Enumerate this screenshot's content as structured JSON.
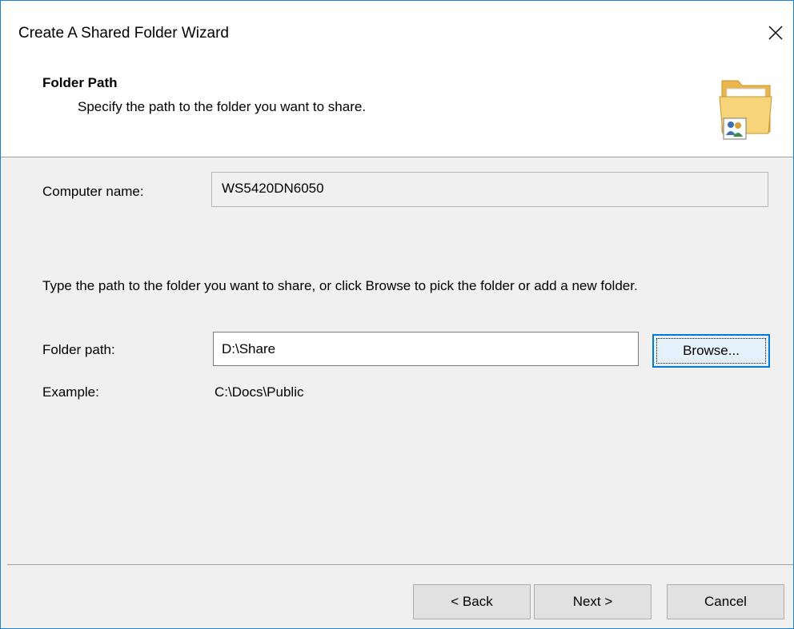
{
  "window": {
    "title": "Create A Shared Folder Wizard"
  },
  "header": {
    "title": "Folder Path",
    "subtitle": "Specify the path to the folder you want to share."
  },
  "computer_name": {
    "label": "Computer name:",
    "value": "WS5420DN6050"
  },
  "instructions": "Type the path to the folder you want to share, or click Browse to pick the folder or add a new folder.",
  "folder_path": {
    "label": "Folder path:",
    "value": "D:\\Share",
    "browse_label": "Browse..."
  },
  "example": {
    "label": "Example:",
    "value": "C:\\Docs\\Public"
  },
  "footer": {
    "back_label": "< Back",
    "next_label": "Next >",
    "cancel_label": "Cancel"
  },
  "icons": {
    "close": "close-icon",
    "header": "shared-folder-icon"
  },
  "colors": {
    "window_border": "#1883d7",
    "focus_border": "#0078d7",
    "background": "#f0f0f0"
  }
}
